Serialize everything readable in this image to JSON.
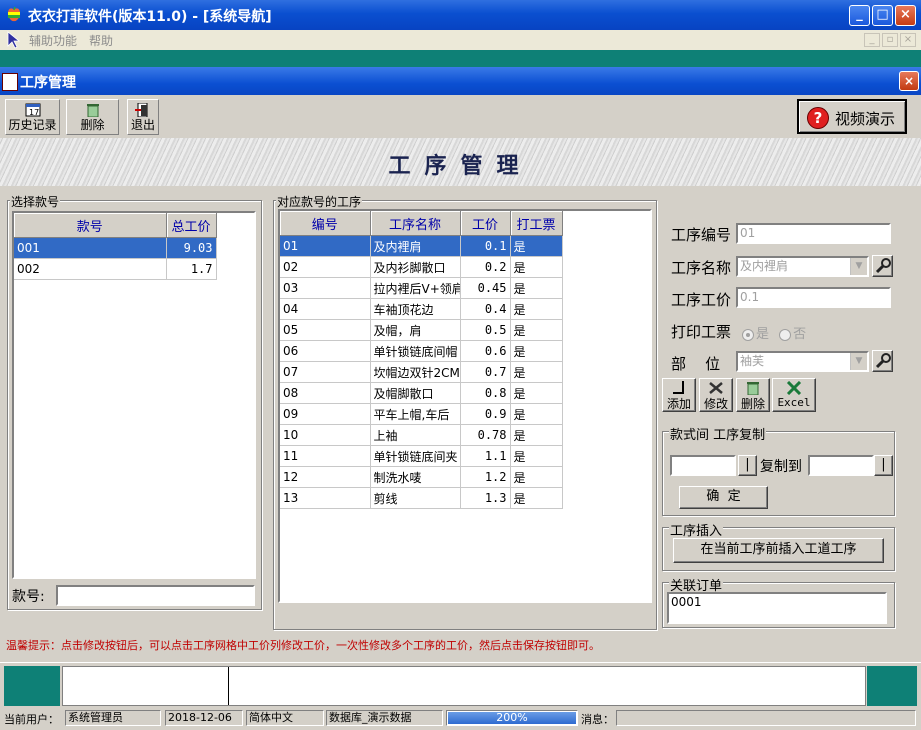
{
  "app": {
    "title": "衣衣打菲软件(版本11.0) - [系统导航]"
  },
  "menu": {
    "items": [
      "辅助功能",
      "帮助"
    ]
  },
  "window": {
    "title": "工序管理"
  },
  "toolbar": {
    "history": "历史记录",
    "delete": "删除",
    "exit": "退出",
    "video": "视频演示"
  },
  "banner": {
    "title": "工序管理"
  },
  "left_panel": {
    "group_label": "选择款号",
    "columns": [
      "款号",
      "总工价"
    ],
    "rows": [
      {
        "code": "001",
        "total": "9.03",
        "selected": true
      },
      {
        "code": "002",
        "total": "1.7",
        "selected": false
      }
    ],
    "search_label": "款号:",
    "search_value": ""
  },
  "process_panel": {
    "group_label": "对应款号的工序",
    "columns": [
      "编号",
      "工序名称",
      "工价",
      "打工票"
    ],
    "rows": [
      {
        "no": "01",
        "name": "及内裡肩",
        "price": "0.1",
        "ticket": "是",
        "selected": true
      },
      {
        "no": "02",
        "name": "及内衫脚散口",
        "price": "0.2",
        "ticket": "是"
      },
      {
        "no": "03",
        "name": "拉内裡后V+领肩",
        "price": "0.45",
        "ticket": "是"
      },
      {
        "no": "04",
        "name": "车袖顶花边",
        "price": "0.4",
        "ticket": "是"
      },
      {
        "no": "05",
        "name": "及帽，肩",
        "price": "0.5",
        "ticket": "是"
      },
      {
        "no": "06",
        "name": "单针锁链底间帽",
        "price": "0.6",
        "ticket": "是"
      },
      {
        "no": "07",
        "name": "坎帽边双针2CM",
        "price": "0.7",
        "ticket": "是"
      },
      {
        "no": "08",
        "name": "及帽脚散口",
        "price": "0.8",
        "ticket": "是"
      },
      {
        "no": "09",
        "name": "平车上帽,车后",
        "price": "0.9",
        "ticket": "是"
      },
      {
        "no": "10",
        "name": "上袖",
        "price": "0.78",
        "ticket": "是"
      },
      {
        "no": "11",
        "name": "单针锁链底间夹",
        "price": "1.1",
        "ticket": "是"
      },
      {
        "no": "12",
        "name": "制洗水唛",
        "price": "1.2",
        "ticket": "是"
      },
      {
        "no": "13",
        "name": "剪线",
        "price": "1.3",
        "ticket": "是"
      }
    ]
  },
  "form": {
    "code_label": "工序编号",
    "code_value": "01",
    "name_label": "工序名称",
    "name_value": "及内裡肩",
    "price_label": "工序工价",
    "price_value": "0.1",
    "ticket_label": "打印工票",
    "ticket_yes": "是",
    "ticket_no": "否",
    "dept_label": "部    位",
    "dept_value": "袖芙",
    "add": "添加",
    "edit": "修改",
    "delete": "删除",
    "excel": "Excel"
  },
  "copy_group": {
    "label": "款式间 工序复制",
    "copy_to": "复制到",
    "confirm": "确  定",
    "browse": "|"
  },
  "insert_group": {
    "label": "工序插入",
    "button": "在当前工序前插入工道工序"
  },
  "order_group": {
    "label": "关联订单",
    "value": "0001"
  },
  "tip": "温馨提示：点击修改按钮后，可以点击工序网格中工价列修改工价，一次性修改多个工序的工价，然后点击保存按钮即可。",
  "status": {
    "user_label": "当前用户：",
    "user": "系统管理员",
    "date": "2018-12-06",
    "lang": "简体中文",
    "db": "数据库_演示数据",
    "progress": "200%",
    "message_label": "消息："
  },
  "colors": {
    "title_blue": "#0a4fd0",
    "teal": "#0e8076",
    "selection": "#316ac5",
    "tip_red": "#c00000"
  }
}
